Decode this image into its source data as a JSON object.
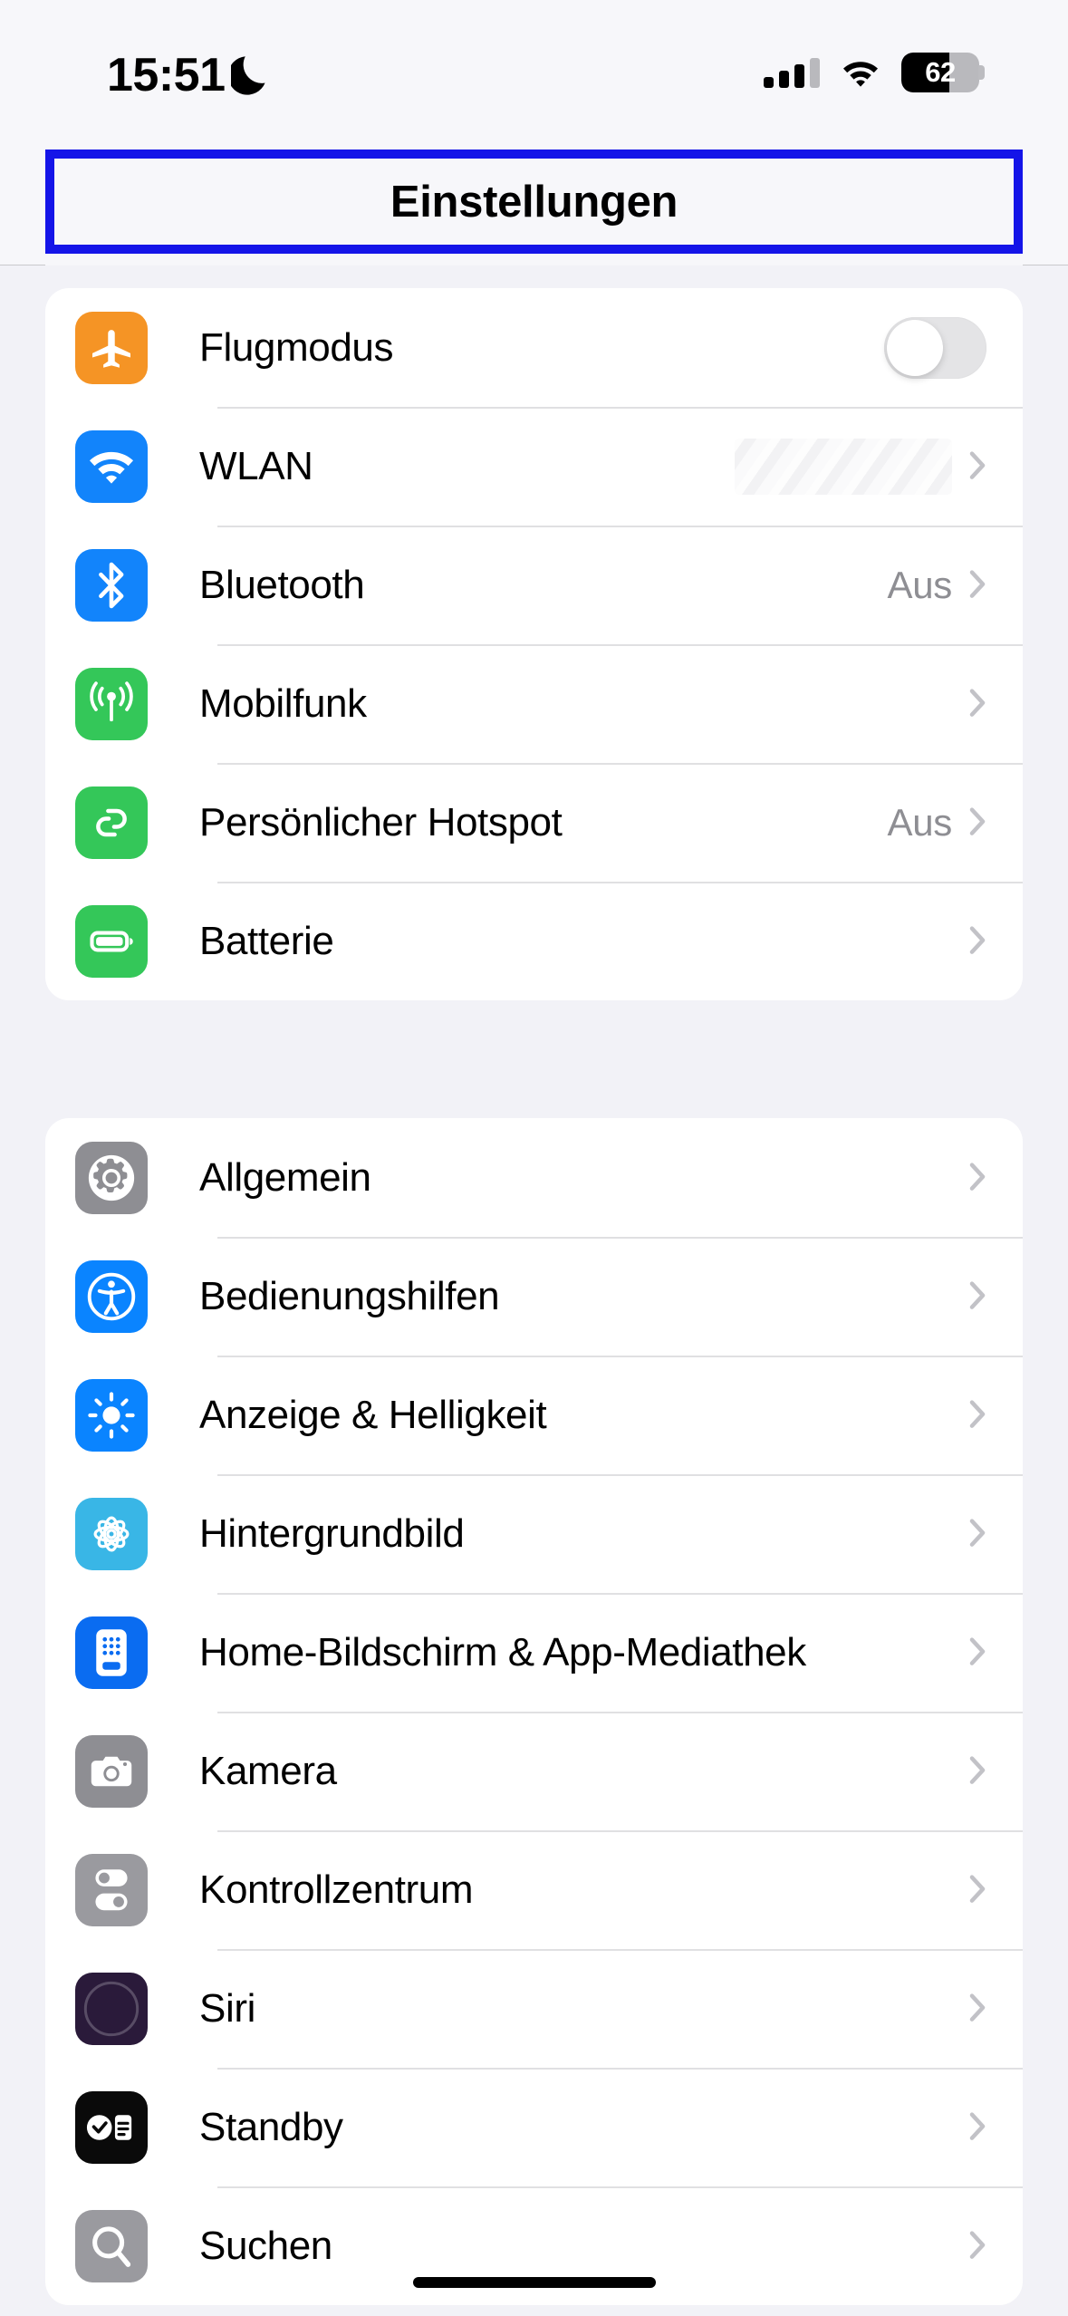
{
  "status_bar": {
    "time": "15:51",
    "dnd_icon": "crescent-moon-icon",
    "cellular_icon": "cellular-signal-icon",
    "cellular_bars_filled": 3,
    "cellular_bars_total": 4,
    "wifi_icon": "wifi-icon",
    "battery_icon": "battery-icon",
    "battery_percent": "62"
  },
  "nav": {
    "title": "Einstellungen",
    "highlight_color": "#1414e8"
  },
  "groups": [
    {
      "id": "connectivity",
      "rows": [
        {
          "label": "Flugmodus",
          "icon": "airplane-icon",
          "icon_bg": "#f59425",
          "control": "toggle",
          "toggle_on": false
        },
        {
          "label": "WLAN",
          "icon": "wifi-icon",
          "icon_bg": "#1284fb",
          "control": "redacted-chevron",
          "value": ""
        },
        {
          "label": "Bluetooth",
          "icon": "bluetooth-icon",
          "icon_bg": "#1284fb",
          "control": "value-chevron",
          "value": "Aus"
        },
        {
          "label": "Mobilfunk",
          "icon": "antenna-icon",
          "icon_bg": "#34c759",
          "control": "chevron",
          "value": ""
        },
        {
          "label": "Persönlicher Hotspot",
          "icon": "hotspot-link-icon",
          "icon_bg": "#34c759",
          "control": "value-chevron",
          "value": "Aus"
        },
        {
          "label": "Batterie",
          "icon": "battery-icon",
          "icon_bg": "#34c759",
          "control": "chevron",
          "value": ""
        }
      ]
    },
    {
      "id": "system",
      "rows": [
        {
          "label": "Allgemein",
          "icon": "gear-icon",
          "icon_bg": "#8e8e93",
          "control": "chevron",
          "value": ""
        },
        {
          "label": "Bedienungshilfen",
          "icon": "accessibility-icon",
          "icon_bg": "#0a84ff",
          "control": "chevron",
          "value": ""
        },
        {
          "label": "Anzeige & Helligkeit",
          "icon": "brightness-sun-icon",
          "icon_bg": "#0a84ff",
          "control": "chevron",
          "value": ""
        },
        {
          "label": "Hintergrundbild",
          "icon": "wallpaper-flower-icon",
          "icon_bg": "#39b6e6",
          "control": "chevron",
          "value": ""
        },
        {
          "label": "Home-Bildschirm & App-Mediathek",
          "icon": "home-screen-icon",
          "icon_bg": "#0a6cf1",
          "control": "chevron",
          "value": ""
        },
        {
          "label": "Kamera",
          "icon": "camera-icon",
          "icon_bg": "#8e8e93",
          "control": "chevron",
          "value": ""
        },
        {
          "label": "Kontrollzentrum",
          "icon": "control-center-icon",
          "icon_bg": "#9a9a9f",
          "control": "chevron",
          "value": ""
        },
        {
          "label": "Siri",
          "icon": "siri-orb-icon",
          "icon_bg": "#2a1a3a",
          "control": "chevron",
          "value": ""
        },
        {
          "label": "Standby",
          "icon": "standby-icon",
          "icon_bg": "#0a0a0a",
          "control": "chevron",
          "value": ""
        },
        {
          "label": "Suchen",
          "icon": "search-magnifier-icon",
          "icon_bg": "#9a9a9f",
          "control": "chevron",
          "value": ""
        }
      ]
    }
  ],
  "home_indicator": "home-indicator-bar"
}
